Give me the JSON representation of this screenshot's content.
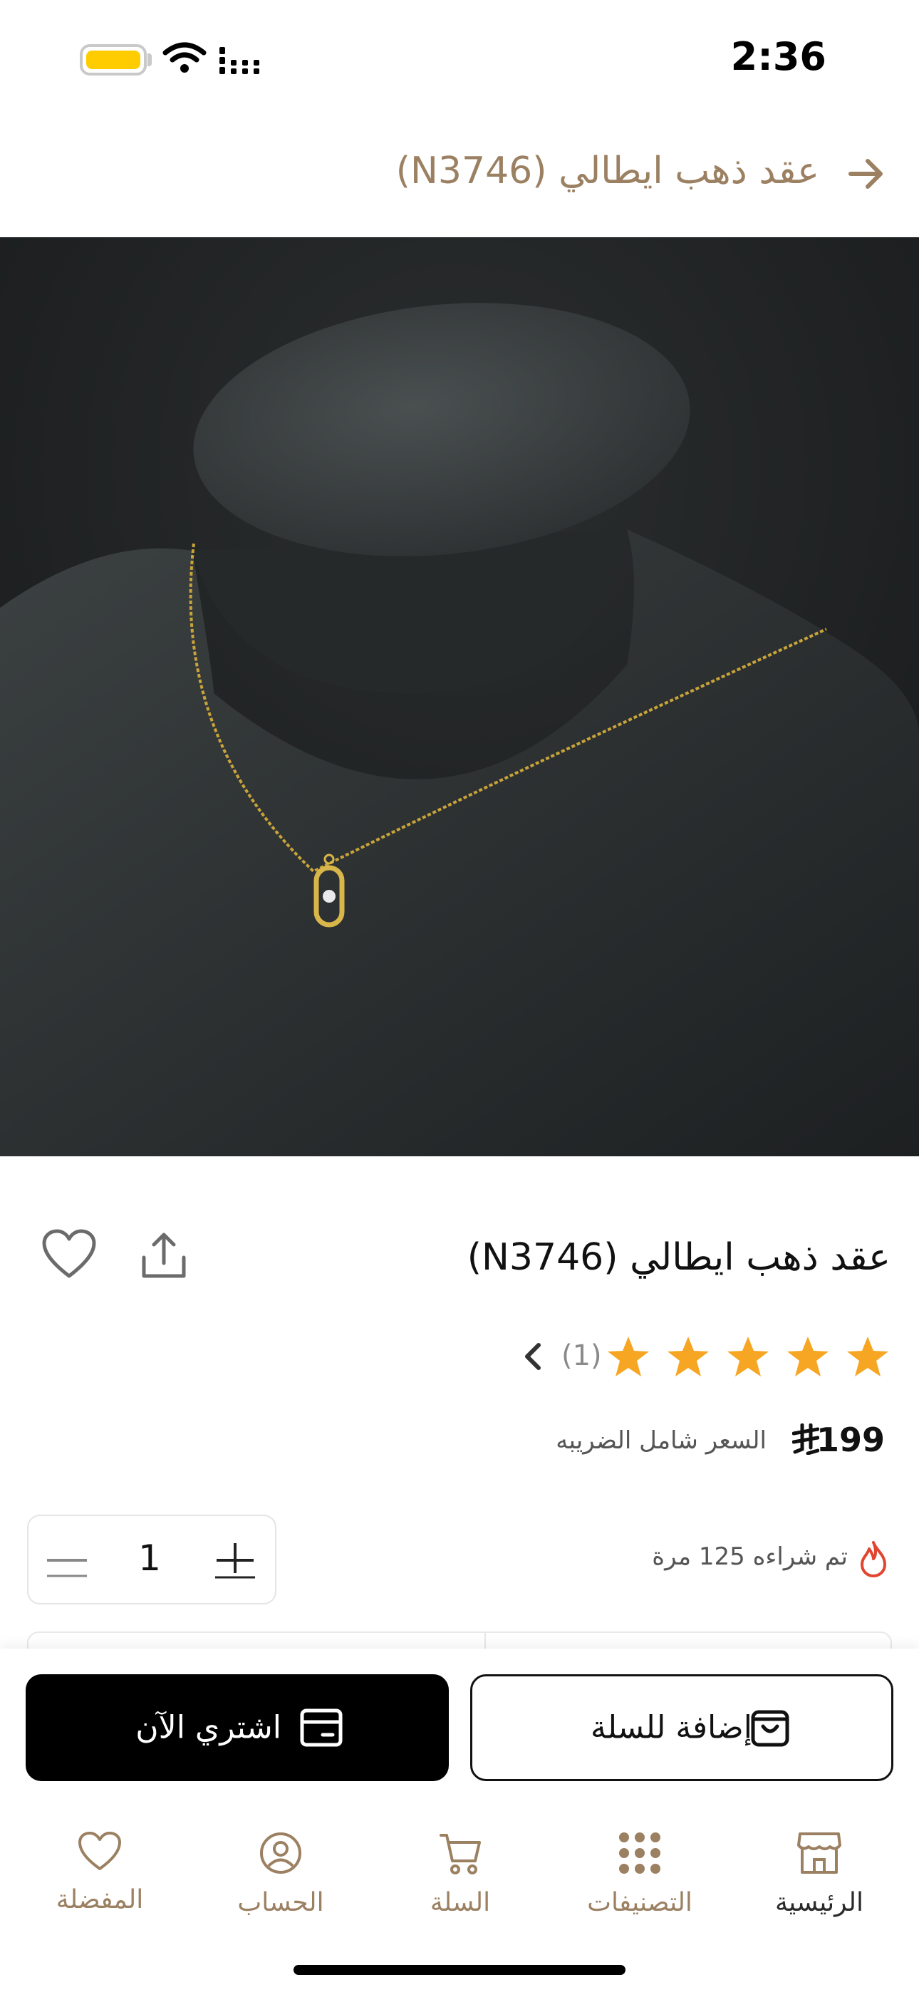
{
  "status_bar": {
    "time": "2:36"
  },
  "header": {
    "title": "عقد ذهب ايطالي  (N3746)"
  },
  "product": {
    "name": "عقد ذهب ايطالي  (N3746)",
    "rating": 5,
    "rating_count": "(1)",
    "price": "199",
    "price_note": "السعر شامل الضريبه",
    "sold_note": "تم شراءه 125 مرة",
    "quantity": "1"
  },
  "actions": {
    "add_to_cart": "إضافة للسلة",
    "buy_now": "اشتري الآن"
  },
  "tabbar": {
    "items": [
      {
        "label": "الرئيسية",
        "icon": "store-icon"
      },
      {
        "label": "التصنيفات",
        "icon": "grid-dots-icon"
      },
      {
        "label": "السلة",
        "icon": "cart-icon"
      },
      {
        "label": "الحساب",
        "icon": "user-circle-icon"
      },
      {
        "label": "المفضلة",
        "icon": "heart-icon"
      }
    ]
  },
  "colors": {
    "accent": "#9b8062",
    "star": "#f6a623",
    "primary_button": "#000000",
    "flame": "#e2452f"
  }
}
